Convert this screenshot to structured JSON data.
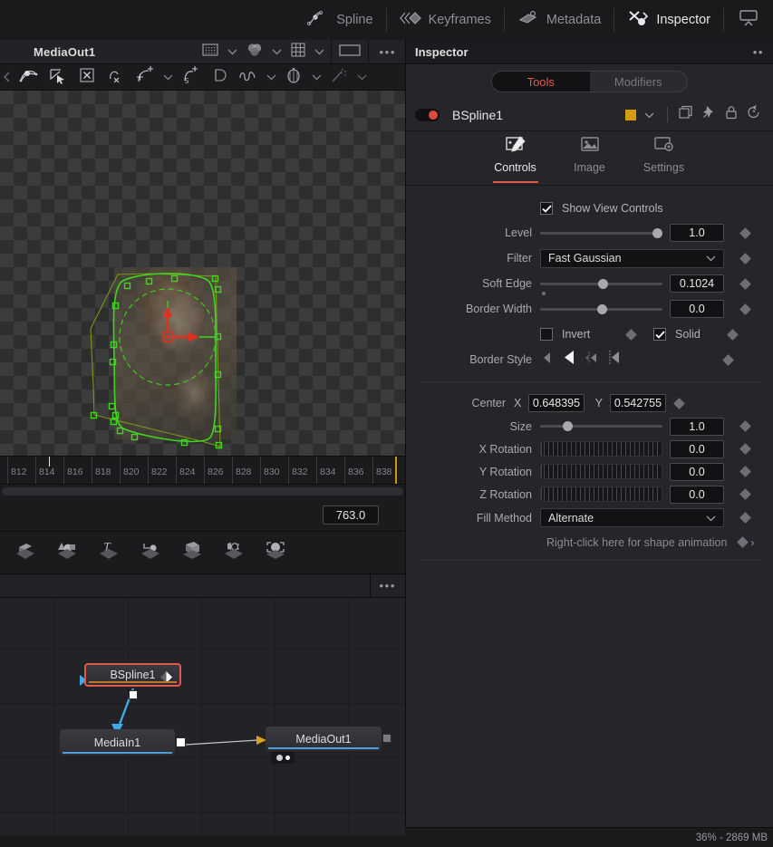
{
  "topbar": {
    "items": [
      {
        "label": "Spline",
        "icon": "spline-icon",
        "active": false
      },
      {
        "label": "Keyframes",
        "icon": "keyframes-icon",
        "active": false
      },
      {
        "label": "Metadata",
        "icon": "metadata-icon",
        "active": false
      },
      {
        "label": "Inspector",
        "icon": "inspector-icon",
        "active": true
      }
    ],
    "panel_toggle_icon": "panel-toggle-icon"
  },
  "viewer": {
    "title": "MediaOut1",
    "header_buttons": [
      "region-of-interest-icon",
      "chevron-down-icon",
      "color-channels-icon",
      "chevron-down-icon",
      "grid-icon",
      "chevron-down-icon"
    ],
    "aspect_button": "aspect-rect-icon",
    "overflow": "•••",
    "toolbar_icons": [
      "polyline-point-icon",
      "select-arrow-icon",
      "close-box-icon",
      "smooth-remove-icon",
      "insert-point-icon",
      "chevron-down-icon",
      "reduce-points-icon",
      "duplicate-icon",
      "bezier-wave-icon",
      "chevron-down-icon",
      "onion-skin-icon",
      "chevron-down-icon",
      "magic-wand-icon",
      "chevron-down-icon"
    ]
  },
  "timeline": {
    "ticks": [
      "812",
      "814",
      "816",
      "818",
      "820",
      "822",
      "824",
      "826",
      "828",
      "830",
      "832",
      "834",
      "836",
      "838"
    ],
    "playhead_frame": "813",
    "current_frame": "763.0"
  },
  "toolstrip": {
    "icons": [
      "3d-plane-icon",
      "3d-shapes-icon",
      "3d-text-icon",
      "3d-transform-icon",
      "3d-cube-icon",
      "3d-camera-icon",
      "3d-render-icon"
    ]
  },
  "nodegraph": {
    "overflow": "•••",
    "nodes": [
      {
        "name": "BSpline1",
        "selected": true,
        "underline": "#c07820",
        "has_keyframe_badge": true
      },
      {
        "name": "MediaIn1",
        "selected": false,
        "underline": "#4a9fd8",
        "has_keyframe_badge": false
      },
      {
        "name": "MediaOut1",
        "selected": false,
        "underline": "#4a9fd8",
        "has_keyframe_badge": false
      }
    ]
  },
  "inspector": {
    "title": "Inspector",
    "overflow": "••",
    "tabs": [
      {
        "label": "Tools",
        "active": true
      },
      {
        "label": "Modifiers",
        "active": false
      }
    ],
    "tool": {
      "name": "BSpline1",
      "enabled": true,
      "swatch_color": "#d39b12",
      "buttons": [
        "copy-icon",
        "pin-icon",
        "lock-icon",
        "reset-icon"
      ]
    },
    "subtabs": [
      {
        "label": "Controls",
        "icon": "controls-icon",
        "active": true
      },
      {
        "label": "Image",
        "icon": "image-icon",
        "active": false
      },
      {
        "label": "Settings",
        "icon": "settings-gear-icon",
        "active": false
      }
    ],
    "controls": {
      "show_view_controls": {
        "label": "Show View Controls",
        "checked": true
      },
      "level": {
        "label": "Level",
        "value": "1.0",
        "slider_pct": 100
      },
      "filter": {
        "label": "Filter",
        "value": "Fast Gaussian"
      },
      "soft_edge": {
        "label": "Soft Edge",
        "value": "0.1024",
        "slider_pct": 50
      },
      "border_width": {
        "label": "Border Width",
        "value": "0.0",
        "slider_pct": 50
      },
      "invert": {
        "label": "Invert",
        "checked": false
      },
      "solid": {
        "label": "Solid",
        "checked": true
      },
      "border_style": {
        "label": "Border Style",
        "selected_index": 1,
        "options": [
          "style-solid-left-icon",
          "style-solid-bold-icon",
          "style-dotted-small-icon",
          "style-dotted-large-icon"
        ]
      },
      "center": {
        "label": "Center",
        "x_label": "X",
        "x_value": "0.648395",
        "y_label": "Y",
        "y_value": "0.542755"
      },
      "size": {
        "label": "Size",
        "value": "1.0",
        "slider_pct": 19
      },
      "x_rotation": {
        "label": "X Rotation",
        "value": "0.0"
      },
      "y_rotation": {
        "label": "Y Rotation",
        "value": "0.0"
      },
      "z_rotation": {
        "label": "Z Rotation",
        "value": "0.0"
      },
      "fill_method": {
        "label": "Fill Method",
        "value": "Alternate"
      },
      "shape_animation_hint": "Right-click here for shape animation"
    }
  },
  "statusbar": {
    "text": "36% - 2869 MB"
  },
  "colors": {
    "accent_red": "#e2584a",
    "panel_bg": "#25252a",
    "spline_green": "#3fd61f",
    "handle_red": "#e03020",
    "node_selected": "#e2584a",
    "link_blue": "#3fa9e0",
    "link_yellow": "#e0a020"
  }
}
